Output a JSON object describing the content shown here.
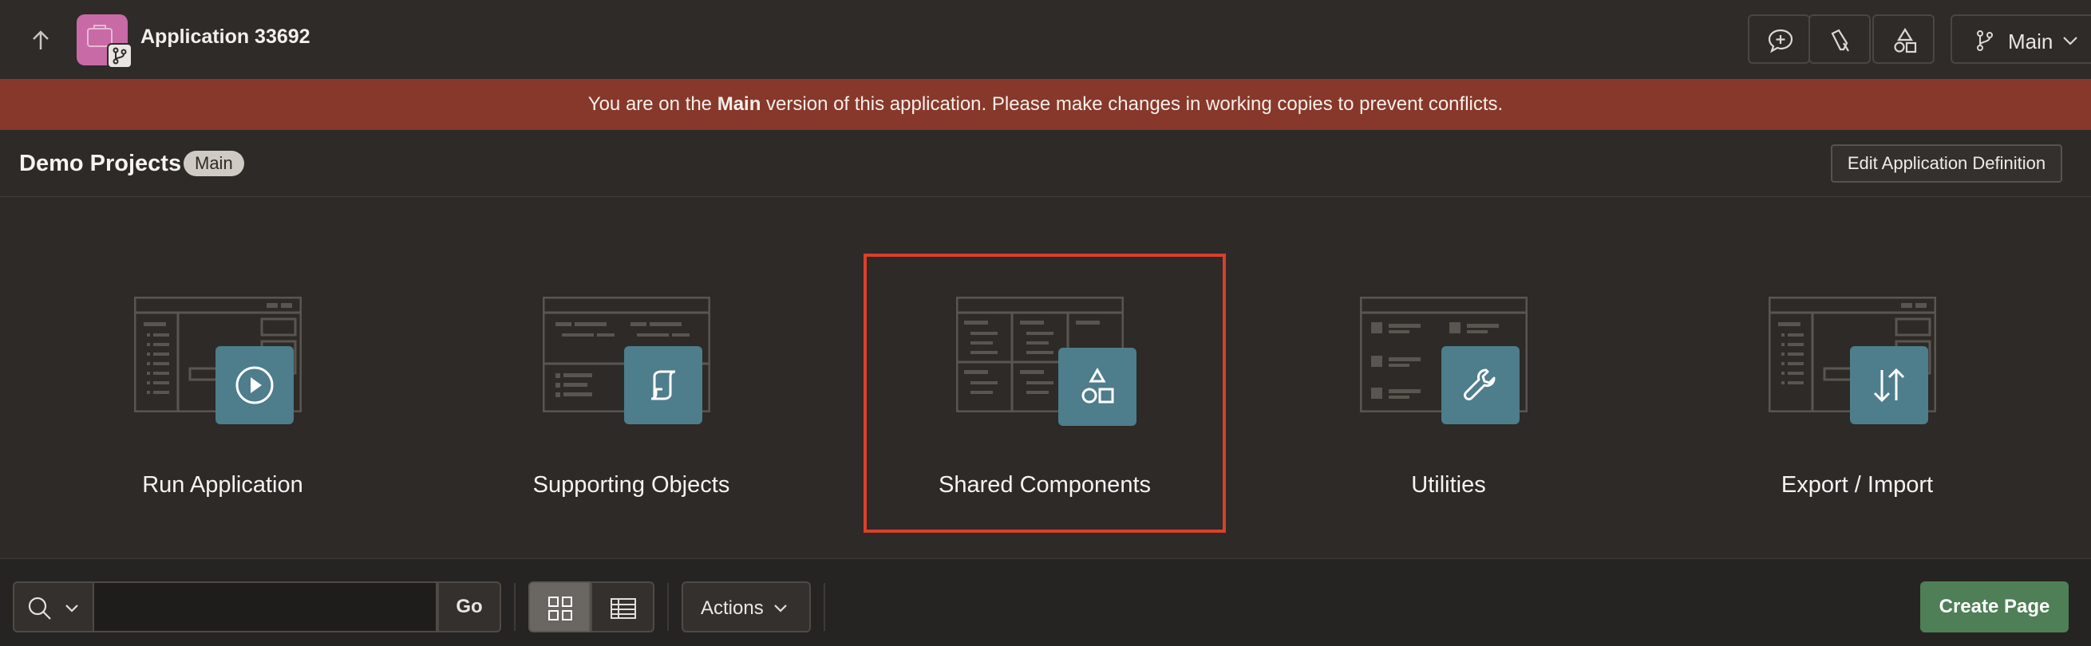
{
  "header": {
    "app_title": "Application 33692",
    "branch_label": "Main",
    "icons": [
      "up-arrow-icon",
      "app-icon",
      "branch-icon",
      "comment-add-icon",
      "flashlight-icon",
      "shapes-icon",
      "chevron-down-icon"
    ]
  },
  "banner": {
    "text_before": "You are on the ",
    "text_bold": "Main",
    "text_after": " version of this application. Please make changes in working copies to prevent conflicts.",
    "color": "#87382a"
  },
  "subheader": {
    "title": "Demo Projects",
    "badge": "Main",
    "edit_button": "Edit Application Definition"
  },
  "tiles": [
    {
      "label": "Run Application",
      "icon": "play-icon"
    },
    {
      "label": "Supporting Objects",
      "icon": "scroll-icon"
    },
    {
      "label": "Shared Components",
      "icon": "shapes-icon",
      "selected": true
    },
    {
      "label": "Utilities",
      "icon": "wrench-icon"
    },
    {
      "label": "Export / Import",
      "icon": "transfer-arrows-icon"
    }
  ],
  "toolbar": {
    "search_placeholder": "",
    "go_label": "Go",
    "actions_label": "Actions",
    "create_label": "Create Page"
  },
  "colors": {
    "accent_teal": "#4e7d8c",
    "create_green": "#4e7f57",
    "selection_red": "#d9402b"
  }
}
